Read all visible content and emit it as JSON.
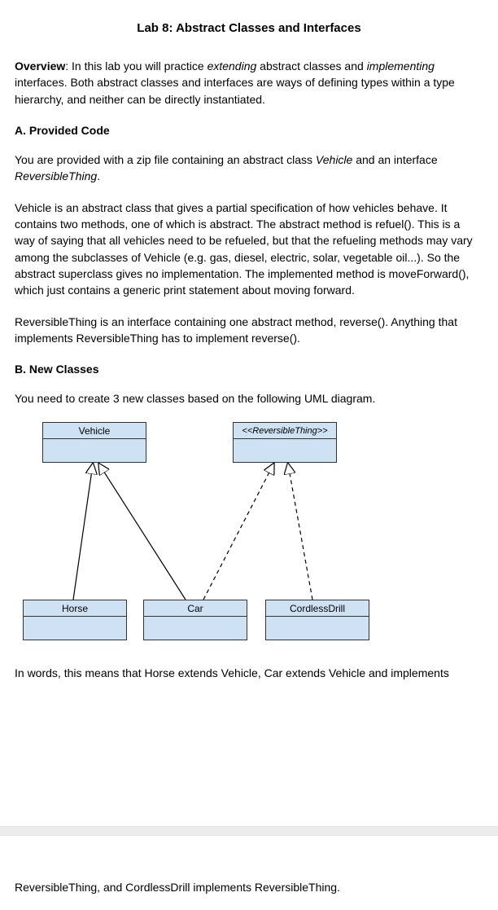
{
  "title": "Lab 8: Abstract Classes and Interfaces",
  "overview": {
    "label": "Overview",
    "t1": ": In this lab you will practice ",
    "em1": "extending",
    "t2": " abstract classes and ",
    "em2": "implementing",
    "t3": " interfaces. Both abstract classes and interfaces are ways of defining types within a type hierarchy, and neither can be directly instantiated."
  },
  "sectionA": {
    "heading": "A. Provided Code",
    "p1a": "You are provided with a zip file containing an abstract class ",
    "p1em1": "Vehicle",
    "p1b": " and an interface ",
    "p1em2": "ReversibleThing",
    "p1c": ".",
    "p2": "Vehicle is an abstract class that gives a partial specification of how vehicles behave. It contains two methods, one of which is abstract. The abstract method is refuel(). This is a way of saying that all vehicles need to be refueled, but that the refueling methods may vary among the subclasses of Vehicle (e.g. gas, diesel, electric, solar, vegetable oil...). So the abstract superclass gives no implementation. The implemented method is moveForward(), which just contains a generic print statement about moving forward.",
    "p3": "ReversibleThing is an interface containing one abstract method, reverse(). Anything that implements ReversibleThing has to implement reverse()."
  },
  "sectionB": {
    "heading": "B. New Classes",
    "intro": "You need to create 3 new classes based on the following UML diagram.",
    "uml": {
      "vehicle": "Vehicle",
      "reversible": "<<ReversibleThing>>",
      "horse": "Horse",
      "car": "Car",
      "drill": "CordlessDrill"
    },
    "caption": "In words, this means that Horse extends Vehicle, Car extends Vehicle and implements",
    "trailing": "ReversibleThing, and CordlessDrill implements ReversibleThing."
  }
}
